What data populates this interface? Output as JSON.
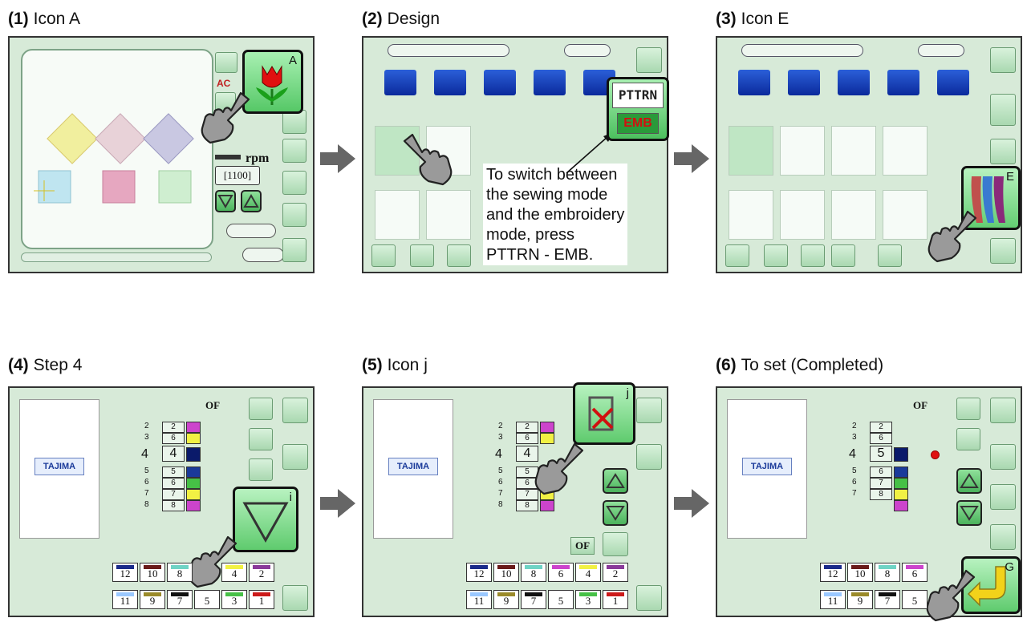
{
  "steps": [
    {
      "num": "(1)",
      "label": "Icon A",
      "callout": "A"
    },
    {
      "num": "(2)",
      "label": "Design"
    },
    {
      "num": "(3)",
      "label": "Icon E",
      "callout": "E"
    },
    {
      "num": "(4)",
      "label": "Step 4",
      "callout": "i"
    },
    {
      "num": "(5)",
      "label": "Icon j",
      "callout": "j"
    },
    {
      "num": "(6)",
      "label": "To set (Completed)",
      "callout": "G"
    }
  ],
  "note_lines": [
    "To switch between",
    "the sewing mode",
    "and the embroidery",
    "mode, press",
    "PTTRN - EMB."
  ],
  "pttrn_button": {
    "top": "PTTRN",
    "bottom": "EMB"
  },
  "screen1": {
    "rpm_label": "rpm",
    "speed": "[1100]",
    "ac": "AC"
  },
  "screen4": {
    "of": "OF",
    "logo": "TAJIMA",
    "rows": [
      "2",
      "3",
      "4",
      "5",
      "6",
      "7",
      "8"
    ],
    "vals": [
      "2",
      "6",
      "4",
      "5",
      "6",
      "7",
      "8"
    ]
  },
  "screen5": {
    "of": "OF",
    "logo": "TAJIMA",
    "rows": [
      "2",
      "3",
      "4",
      "5",
      "6",
      "7",
      "8"
    ],
    "vals": [
      "2",
      "6",
      "4",
      "5",
      "6",
      "7",
      "8"
    ]
  },
  "screen6": {
    "of": "OF",
    "logo": "TAJIMA",
    "rows": [
      "2",
      "3",
      "4",
      "5",
      "6",
      "7"
    ],
    "vals": [
      "2",
      "6",
      "5",
      "6",
      "7",
      "8"
    ]
  },
  "needle_tabs_top": [
    "12",
    "10",
    "8",
    "6",
    "4",
    "2"
  ],
  "needle_tabs_bottom": [
    "11",
    "9",
    "7",
    "5",
    "3",
    "1"
  ],
  "tab_colors_top": [
    "#1a2a8a",
    "#6a1a1a",
    "#6fd3c5",
    "#cc44cc",
    "#f1f144",
    "#8a3a9a"
  ],
  "tab_colors_bottom": [
    "#9ac8ff",
    "#9a8a2a",
    "#111111",
    "#ffffff",
    "#46c046",
    "#cc1a1a"
  ]
}
